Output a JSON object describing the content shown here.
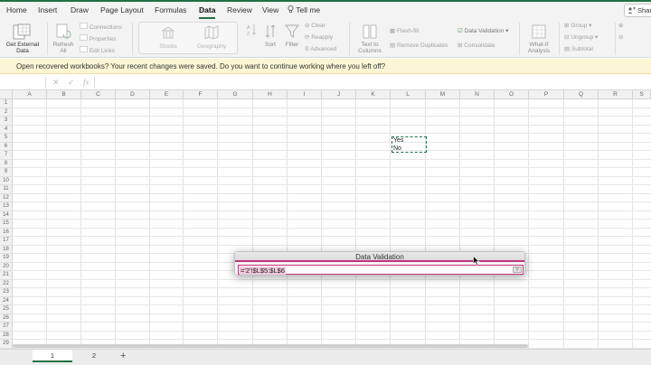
{
  "tabs": [
    {
      "label": "Home",
      "active": false
    },
    {
      "label": "Insert",
      "active": false
    },
    {
      "label": "Draw",
      "active": false
    },
    {
      "label": "Page Layout",
      "active": false
    },
    {
      "label": "Formulas",
      "active": false
    },
    {
      "label": "Data",
      "active": true
    },
    {
      "label": "Review",
      "active": false
    },
    {
      "label": "View",
      "active": false
    }
  ],
  "tell_me": "Tell me",
  "share": "Share",
  "ribbon": {
    "get_external_data": "Get External Data",
    "refresh_all": "Refresh All",
    "connections": "Connections",
    "properties": "Properties",
    "edit_links": "Edit Links",
    "stocks": "Stocks",
    "geography": "Geography",
    "sort": "Sort",
    "filter": "Filter",
    "clear": "Clear",
    "reapply": "Reapply",
    "advanced": "Advanced",
    "text_to_columns": "Text to Columns",
    "flash_fill": "Flash-fill",
    "remove_duplicates": "Remove Duplicates",
    "data_validation": "Data Validation",
    "consolidate": "Consolidate",
    "what_if": "What-If Analysis",
    "group": "Group",
    "ungroup": "Ungroup",
    "subtotal": "Subtotal"
  },
  "message_bar": "Open recovered workbooks?  Your recent changes were saved. Do you want to continue working where you left off?",
  "formula_bar": {
    "cancel": "✕",
    "enter": "✓",
    "fx": "fx"
  },
  "columns": [
    "A",
    "B",
    "C",
    "D",
    "E",
    "F",
    "G",
    "H",
    "I",
    "J",
    "K",
    "L",
    "M",
    "N",
    "O",
    "P",
    "Q",
    "R",
    "S"
  ],
  "rows": [
    "1",
    "2",
    "3",
    "4",
    "5",
    "6",
    "7",
    "8",
    "9",
    "10",
    "11",
    "12",
    "13",
    "14",
    "15",
    "16",
    "17",
    "18",
    "19",
    "20",
    "21",
    "22",
    "23",
    "24",
    "25",
    "26",
    "27",
    "28",
    "29"
  ],
  "cells": {
    "L5": "Yes",
    "L6": "No"
  },
  "dialog": {
    "title": "Data Validation",
    "value": "='2'!$L$5:$L$6"
  },
  "sheets": [
    {
      "label": "1",
      "active": true
    },
    {
      "label": "2",
      "active": false
    }
  ],
  "add_sheet": "+"
}
